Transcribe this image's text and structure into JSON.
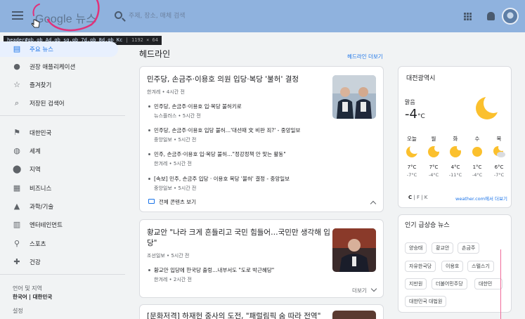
{
  "header": {
    "logo": "Google 뉴스",
    "search_placeholder": "주제, 장소, 매체 검색"
  },
  "tooltip": {
    "selector": "header#gb.gb_Ad.gb_sg.gb_7d.gb_8d.gb_Kc",
    "size": "1192 × 64"
  },
  "sidebar": {
    "items": [
      {
        "label": "주요 뉴스",
        "icon": "news-icon"
      },
      {
        "label": "권장 애플리케이션",
        "icon": "person-icon"
      },
      {
        "label": "즐겨찾기",
        "icon": "star-icon"
      },
      {
        "label": "저장된 검색어",
        "icon": "search-icon"
      },
      {
        "label": "대한민국",
        "icon": "flag-icon"
      },
      {
        "label": "세계",
        "icon": "globe-icon"
      },
      {
        "label": "지역",
        "icon": "location-icon"
      },
      {
        "label": "비즈니스",
        "icon": "building-icon"
      },
      {
        "label": "과학/기술",
        "icon": "flask-icon"
      },
      {
        "label": "엔터테인먼트",
        "icon": "film-icon"
      },
      {
        "label": "스포츠",
        "icon": "bike-icon"
      },
      {
        "label": "건강",
        "icon": "health-icon"
      }
    ],
    "lang_title": "언어 및 지역",
    "lang_value": "한국어 | 대한민국",
    "settings": "설정"
  },
  "main": {
    "section_title": "헤드라인",
    "more_link": "헤드라인 더보기",
    "card1": {
      "title": "민주당, 손금주·이용호 의원 입당·복당 '불허' 결정",
      "meta": "한겨레 • 4시간 전",
      "subs": [
        {
          "title": "민주당, 손금주·이용호 입·복당 불허키로",
          "meta": "뉴스플러스 • 5시간 전"
        },
        {
          "title": "민주당, 손금주·이용호 입당 불허…'대선때 文 비판 죄?' - 중앙일보",
          "meta": "중앙일보 • 5시간 전"
        },
        {
          "title": "민주, 손금주·이용호 입·복당 불허…\"정강정책 안 맞는 활동\"",
          "meta": "한겨레 • 5시간 전"
        },
        {
          "title": "[속보] 민주, 손금주 입당 · 이용호 복당 '불허' 결정 - 중앙일보",
          "meta": "중앙일보 • 5시간 전"
        }
      ],
      "full_coverage": "전체 콘텐츠 보기"
    },
    "card2": {
      "title": "황교안 \"나라 크게 흔들리고 국민 힘들어…국민만 생각해 입당\"",
      "meta": "조선일보 • 5시간 전",
      "subs": [
        {
          "title": "황교안 입당에 한국당 출렁…내부서도 \"도로 박근혜당\"",
          "meta": "한겨레 • 2시간 전"
        }
      ],
      "more": "더보기"
    },
    "card3": {
      "title": "[문화저격] 하재헌 중사의 도전, \"패럴림픽 숨 따라 전역\""
    }
  },
  "weather": {
    "city": "대전광역시",
    "condition": "맑음",
    "temp": "-4",
    "unit": "°C",
    "forecast": [
      {
        "day": "오늘",
        "hi": "7°C",
        "lo": "-7°C",
        "icon": "moon-icon"
      },
      {
        "day": "월",
        "hi": "7°C",
        "lo": "-4°C",
        "icon": "sun-icon"
      },
      {
        "day": "화",
        "hi": "4°C",
        "lo": "-11°C",
        "icon": "sun-icon"
      },
      {
        "day": "수",
        "hi": "1°C",
        "lo": "-4°C",
        "icon": "sun-icon"
      },
      {
        "day": "목",
        "hi": "6°C",
        "lo": "-7°C",
        "icon": "partly-cloudy-icon"
      }
    ],
    "units": {
      "c": "C",
      "f": "F",
      "k": "K"
    },
    "source_link": "weather.com에서 더보기"
  },
  "trends": {
    "title": "인기 급상승 뉴스",
    "chips": [
      "양승태",
      "황교안",
      "손금주",
      "자유한국당",
      "이용호",
      "스텔스기",
      "지만원",
      "더불어민주당",
      "대한민",
      "대한민국 대법원"
    ]
  },
  "colors": {
    "header_bg": "#8fb2de",
    "link": "#1a73e8",
    "scribble": "#e0327a"
  }
}
